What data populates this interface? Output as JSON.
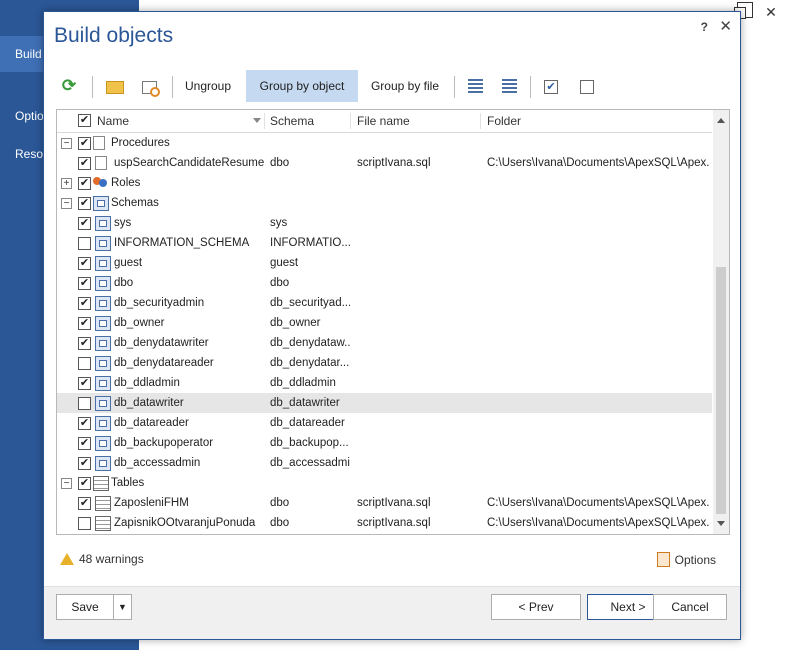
{
  "background": {
    "sidebar_items": [
      "Build",
      "Optio",
      "Resou"
    ]
  },
  "dialog": {
    "title": "Build objects",
    "help": "?",
    "close": "✕"
  },
  "toolbar": {
    "ungroup_label": "Ungroup",
    "group_by_object_label": "Group by object",
    "group_by_file_label": "Group by file",
    "select_all_mark": "✔"
  },
  "grid": {
    "columns": [
      "Name",
      "Schema",
      "File name",
      "Folder"
    ],
    "rows": [
      {
        "type": "group",
        "expander": "−",
        "checked": true,
        "icon": "procedure-icon",
        "name": "Procedures",
        "schema": "",
        "file": "",
        "folder": ""
      },
      {
        "type": "item",
        "checked": true,
        "icon": "procedure-icon",
        "name": "uspSearchCandidateResumes",
        "schema": "dbo",
        "file": "scriptIvana.sql",
        "folder": "C:\\Users\\Ivana\\Documents\\ApexSQL\\Apex..."
      },
      {
        "type": "group",
        "expander": "+",
        "checked": true,
        "icon": "roles-icon",
        "name": "Roles",
        "schema": "",
        "file": "",
        "folder": ""
      },
      {
        "type": "group",
        "expander": "−",
        "checked": true,
        "icon": "schema-icon",
        "name": "Schemas",
        "schema": "",
        "file": "",
        "folder": ""
      },
      {
        "type": "item",
        "checked": true,
        "icon": "schema-icon",
        "name": "sys",
        "schema": "sys",
        "file": "",
        "folder": ""
      },
      {
        "type": "item",
        "checked": false,
        "icon": "schema-icon",
        "name": "INFORMATION_SCHEMA",
        "schema": "INFORMATIO...",
        "file": "",
        "folder": ""
      },
      {
        "type": "item",
        "checked": true,
        "icon": "schema-icon",
        "name": "guest",
        "schema": "guest",
        "file": "",
        "folder": ""
      },
      {
        "type": "item",
        "checked": true,
        "icon": "schema-icon",
        "name": "dbo",
        "schema": "dbo",
        "file": "",
        "folder": ""
      },
      {
        "type": "item",
        "checked": true,
        "icon": "schema-icon",
        "name": "db_securityadmin",
        "schema": "db_securityad...",
        "file": "",
        "folder": ""
      },
      {
        "type": "item",
        "checked": true,
        "icon": "schema-icon",
        "name": "db_owner",
        "schema": "db_owner",
        "file": "",
        "folder": ""
      },
      {
        "type": "item",
        "checked": true,
        "icon": "schema-icon",
        "name": "db_denydatawriter",
        "schema": "db_denydataw...",
        "file": "",
        "folder": ""
      },
      {
        "type": "item",
        "checked": false,
        "icon": "schema-icon",
        "name": "db_denydatareader",
        "schema": "db_denydatar...",
        "file": "",
        "folder": ""
      },
      {
        "type": "item",
        "checked": true,
        "icon": "schema-icon",
        "name": "db_ddladmin",
        "schema": "db_ddladmin",
        "file": "",
        "folder": ""
      },
      {
        "type": "item",
        "checked": false,
        "icon": "schema-icon",
        "name": "db_datawriter",
        "schema": "db_datawriter",
        "file": "",
        "folder": "",
        "selected": true
      },
      {
        "type": "item",
        "checked": true,
        "icon": "schema-icon",
        "name": "db_datareader",
        "schema": "db_datareader",
        "file": "",
        "folder": ""
      },
      {
        "type": "item",
        "checked": true,
        "icon": "schema-icon",
        "name": "db_backupoperator",
        "schema": "db_backupop...",
        "file": "",
        "folder": ""
      },
      {
        "type": "item",
        "checked": true,
        "icon": "schema-icon",
        "name": "db_accessadmin",
        "schema": "db_accessadmin",
        "file": "",
        "folder": ""
      },
      {
        "type": "group",
        "expander": "−",
        "checked": true,
        "icon": "table-icon",
        "name": "Tables",
        "schema": "",
        "file": "",
        "folder": ""
      },
      {
        "type": "item",
        "checked": true,
        "icon": "table-icon",
        "name": "ZaposleniFHM",
        "schema": "dbo",
        "file": "scriptIvana.sql",
        "folder": "C:\\Users\\Ivana\\Documents\\ApexSQL\\Apex..."
      },
      {
        "type": "item",
        "checked": false,
        "icon": "table-icon",
        "name": "ZapisnikOOtvaranjuPonuda",
        "schema": "dbo",
        "file": "scriptIvana.sql",
        "folder": "C:\\Users\\Ivana\\Documents\\ApexSQL\\Apex..."
      }
    ]
  },
  "status": {
    "warnings": "48 warnings",
    "options": "Options"
  },
  "footer": {
    "save": "Save",
    "save_dropdown": "▼",
    "prev": "< Prev",
    "next": "Next >",
    "cancel": "Cancel"
  },
  "colors": {
    "accent": "#2b5797",
    "active_toolbar": "#c5d9f1",
    "selected_row": "#e6e6e6"
  }
}
